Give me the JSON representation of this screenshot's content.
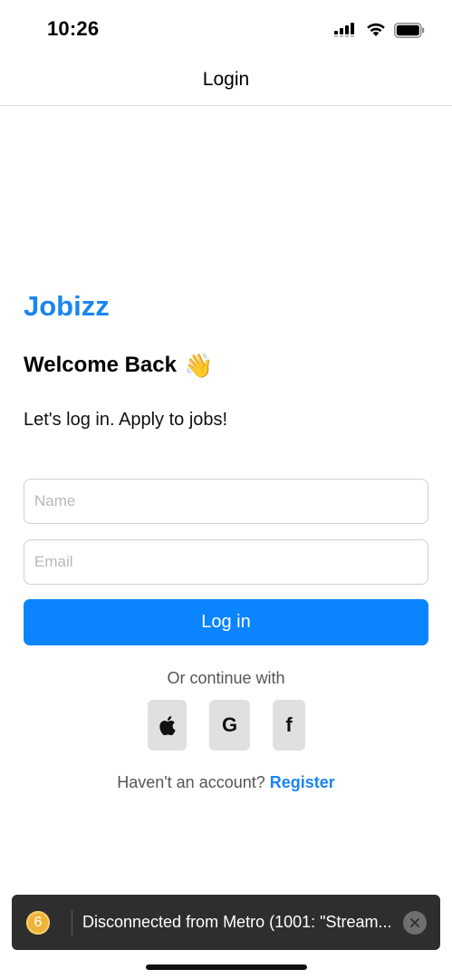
{
  "status_bar": {
    "time": "10:26"
  },
  "header": {
    "title": "Login"
  },
  "brand": {
    "name": "Jobizz"
  },
  "welcome": {
    "text": "Welcome Back",
    "emoji": "👋"
  },
  "subtitle": "Let's log in. Apply to jobs!",
  "form": {
    "name_placeholder": "Name",
    "name_value": "",
    "email_placeholder": "Email",
    "email_value": "",
    "login_label": "Log in"
  },
  "social": {
    "divider_text": "Or continue with",
    "google_label": "G",
    "facebook_label": "f",
    "icons": [
      "apple-icon",
      "google-icon",
      "facebook-icon"
    ]
  },
  "register": {
    "prompt": "Haven't an account?",
    "link_label": "Register"
  },
  "toast": {
    "count": "6",
    "message": "Disconnected from Metro (1001: \"Stream...",
    "icons": [
      "close-icon"
    ]
  },
  "colors": {
    "accent": "#0a84ff",
    "brand": "#1a86f0",
    "toast_bg": "#2e2e2e",
    "badge": "#f0b43a"
  }
}
